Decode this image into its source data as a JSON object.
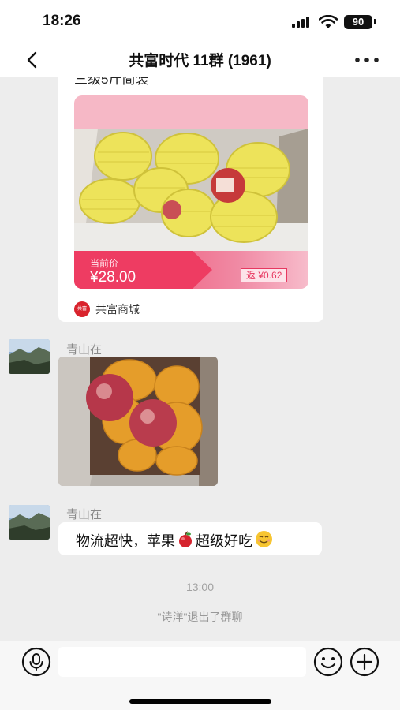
{
  "status_bar": {
    "time": "18:26",
    "battery": "90"
  },
  "nav": {
    "title": "共富时代 11群 (1961)",
    "back_icon": "chevron-left-icon",
    "more_icon": "more-dots-icon"
  },
  "product_card": {
    "top_text": "三级5斤简装",
    "price_label": "当前价",
    "price": "¥28.00",
    "rebate": "返 ¥0.62",
    "shop_name": "共富商城",
    "shop_logo_text": "共富",
    "colors": {
      "ribbon": "#ef3f64",
      "rebate": "#e73860"
    }
  },
  "messages": [
    {
      "sender": "青山在",
      "type": "image"
    },
    {
      "sender": "青山在",
      "type": "text",
      "text_before": "物流超快，苹果",
      "text_after": "超级好吃",
      "emoji": [
        "apple-icon",
        "smile-emoji-icon"
      ]
    }
  ],
  "timestamp": "13:00",
  "system_message": "\"诗洋\"退出了群聊",
  "input_bar": {
    "placeholder": "",
    "voice_icon": "voice-icon",
    "emoji_icon": "emoji-icon",
    "add_icon": "plus-icon"
  }
}
